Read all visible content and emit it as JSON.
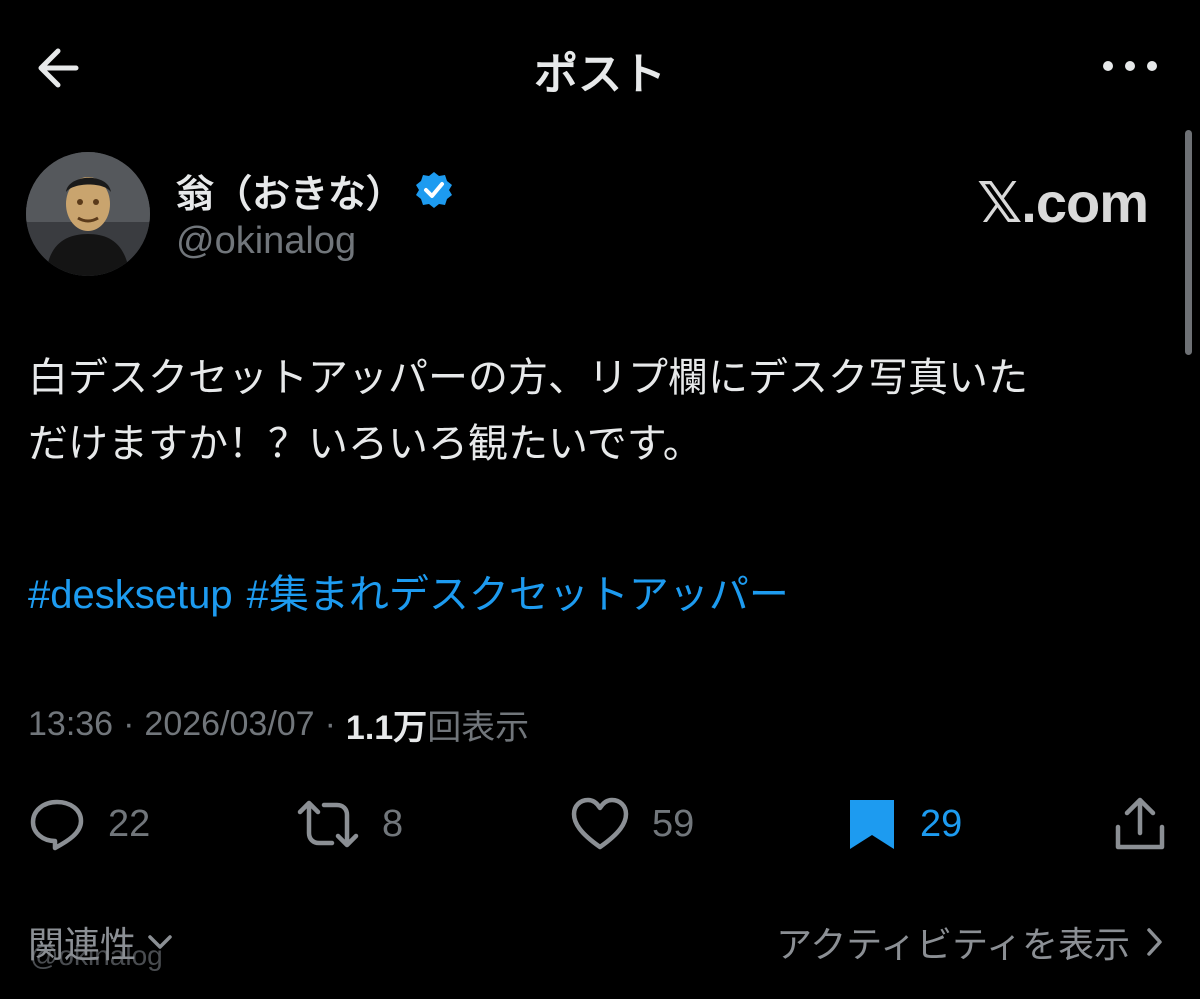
{
  "header": {
    "title": "ポスト"
  },
  "author": {
    "name": "翁（おきな）",
    "handle": "@okinalog",
    "verified": true,
    "source_label": "𝕏.com"
  },
  "post": {
    "text_line1": "白デスクセットアッパーの方、リプ欄にデスク写真いた",
    "text_line2": "だけますか！？いろいろ観たいです。",
    "hashtags": [
      "#desksetup",
      "#集まれデスクセットアッパー"
    ],
    "time": "13:36",
    "separator": "·",
    "date": "2026/03/07",
    "views": "1.1万",
    "views_label": "回表示"
  },
  "actions": {
    "reply_count": "22",
    "repost_count": "8",
    "like_count": "59",
    "bookmark_count": "29",
    "bookmarked": true
  },
  "footer": {
    "sort_label": "関連性",
    "activity_label": "アクティビティを表示",
    "ghost_text": "@okinalog"
  },
  "colors": {
    "background": "#000000",
    "text": "#e7e9ea",
    "muted": "#71767b",
    "accent": "#1d9bf0"
  },
  "icons": {
    "back": "arrow-left-icon",
    "more": "more-horizontal-icon",
    "verified": "verified-badge-icon",
    "reply": "reply-icon",
    "repost": "repost-icon",
    "like": "heart-icon",
    "bookmark": "bookmark-icon",
    "share": "share-icon"
  }
}
